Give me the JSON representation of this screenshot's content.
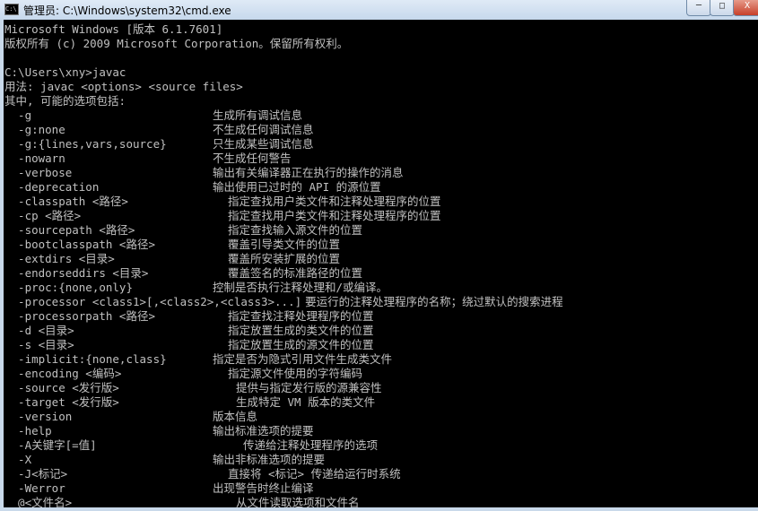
{
  "window": {
    "title": "管理员: C:\\Windows\\system32\\cmd.exe",
    "icon": "cmd-icon",
    "minimize": "─",
    "maximize": "□",
    "close": "X"
  },
  "console": {
    "header": [
      "Microsoft Windows [版本 6.1.7601]",
      "版权所有 (c) 2009 Microsoft Corporation。保留所有权利。",
      "",
      "C:\\Users\\xny>javac",
      "用法: javac <options> <source files>",
      "其中, 可能的选项包括:"
    ],
    "rows": [
      {
        "option": "  -g",
        "desc": "生成所有调试信息"
      },
      {
        "option": "  -g:none",
        "desc": "不生成任何调试信息"
      },
      {
        "option": "  -g:{lines,vars,source}",
        "desc": "只生成某些调试信息"
      },
      {
        "option": "  -nowarn",
        "desc": "不生成任何警告"
      },
      {
        "option": "  -verbose",
        "desc": "输出有关编译器正在执行的操作的消息"
      },
      {
        "option": "  -deprecation",
        "desc": "输出使用已过时的 API 的源位置"
      },
      {
        "option": "  -classpath <路径>",
        "desc": "指定查找用户类文件和注释处理程序的位置"
      },
      {
        "option": "  -cp <路径>",
        "desc": "指定查找用户类文件和注释处理程序的位置"
      },
      {
        "option": "  -sourcepath <路径>",
        "desc": "指定查找输入源文件的位置"
      },
      {
        "option": "  -bootclasspath <路径>",
        "desc": "覆盖引导类文件的位置"
      },
      {
        "option": "  -extdirs <目录>",
        "desc": "覆盖所安装扩展的位置"
      },
      {
        "option": "  -endorseddirs <目录>",
        "desc": "覆盖签名的标准路径的位置"
      },
      {
        "option": "  -proc:{none,only}",
        "desc": "控制是否执行注释处理和/或编译。"
      },
      {
        "option": "  -processor <class1>[,<class2>,<class3>...]",
        "desc": "要运行的注释处理程序的名称；绕过默认的搜索进程"
      },
      {
        "option": "  -processorpath <路径>",
        "desc": "指定查找注释处理程序的位置"
      },
      {
        "option": "  -d <目录>",
        "desc": "指定放置生成的类文件的位置"
      },
      {
        "option": "  -s <目录>",
        "desc": "指定放置生成的源文件的位置"
      },
      {
        "option": "  -implicit:{none,class}",
        "desc": "指定是否为隐式引用文件生成类文件"
      },
      {
        "option": "  -encoding <编码>",
        "desc": "指定源文件使用的字符编码"
      },
      {
        "option": "  -source <发行版>",
        "desc": "提供与指定发行版的源兼容性"
      },
      {
        "option": "  -target <发行版>",
        "desc": "生成特定 VM 版本的类文件"
      },
      {
        "option": "  -version",
        "desc": "版本信息"
      },
      {
        "option": "  -help",
        "desc": "输出标准选项的提要"
      },
      {
        "option": "  -A关键字[=值]",
        "desc": "传递给注释处理程序的选项"
      },
      {
        "option": "  -X",
        "desc": "输出非标准选项的提要"
      },
      {
        "option": "  -J<标记>",
        "desc": "直接将 <标记> 传递给运行时系统"
      },
      {
        "option": "  -Werror",
        "desc": "出现警告时终止编译"
      },
      {
        "option": "  @<文件名>",
        "desc": "从文件读取选项和文件名"
      }
    ]
  }
}
